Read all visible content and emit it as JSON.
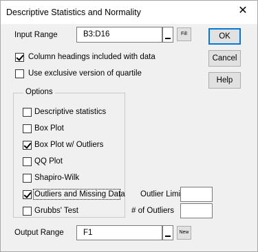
{
  "window": {
    "title": "Descriptive Statistics and Normality"
  },
  "input_range": {
    "label": "Input Range",
    "value": "B3:D16",
    "fill_label": "Fill"
  },
  "checks": {
    "headings": {
      "label": "Column headings included with data",
      "checked": true
    },
    "exclusive_quartile": {
      "label": "Use exclusive version of quartile",
      "checked": false
    }
  },
  "options": {
    "title": "Options",
    "items": [
      {
        "label": "Descriptive statistics",
        "checked": false
      },
      {
        "label": "Box Plot",
        "checked": false
      },
      {
        "label": "Box Plot w/ Outliers",
        "checked": true
      },
      {
        "label": "QQ Plot",
        "checked": false
      },
      {
        "label": "Shapiro-Wilk",
        "checked": false
      },
      {
        "label": "Outliers and Missing Data",
        "checked": true
      },
      {
        "label": "Grubbs' Test",
        "checked": false
      }
    ]
  },
  "outlier_limit": {
    "label": "Outlier Limit",
    "value": ""
  },
  "num_outliers": {
    "label": "# of Outliers",
    "value": ""
  },
  "output_range": {
    "label": "Output Range",
    "value": "F1",
    "new_label": "New"
  },
  "buttons": {
    "ok": "OK",
    "cancel": "Cancel",
    "help": "Help"
  }
}
